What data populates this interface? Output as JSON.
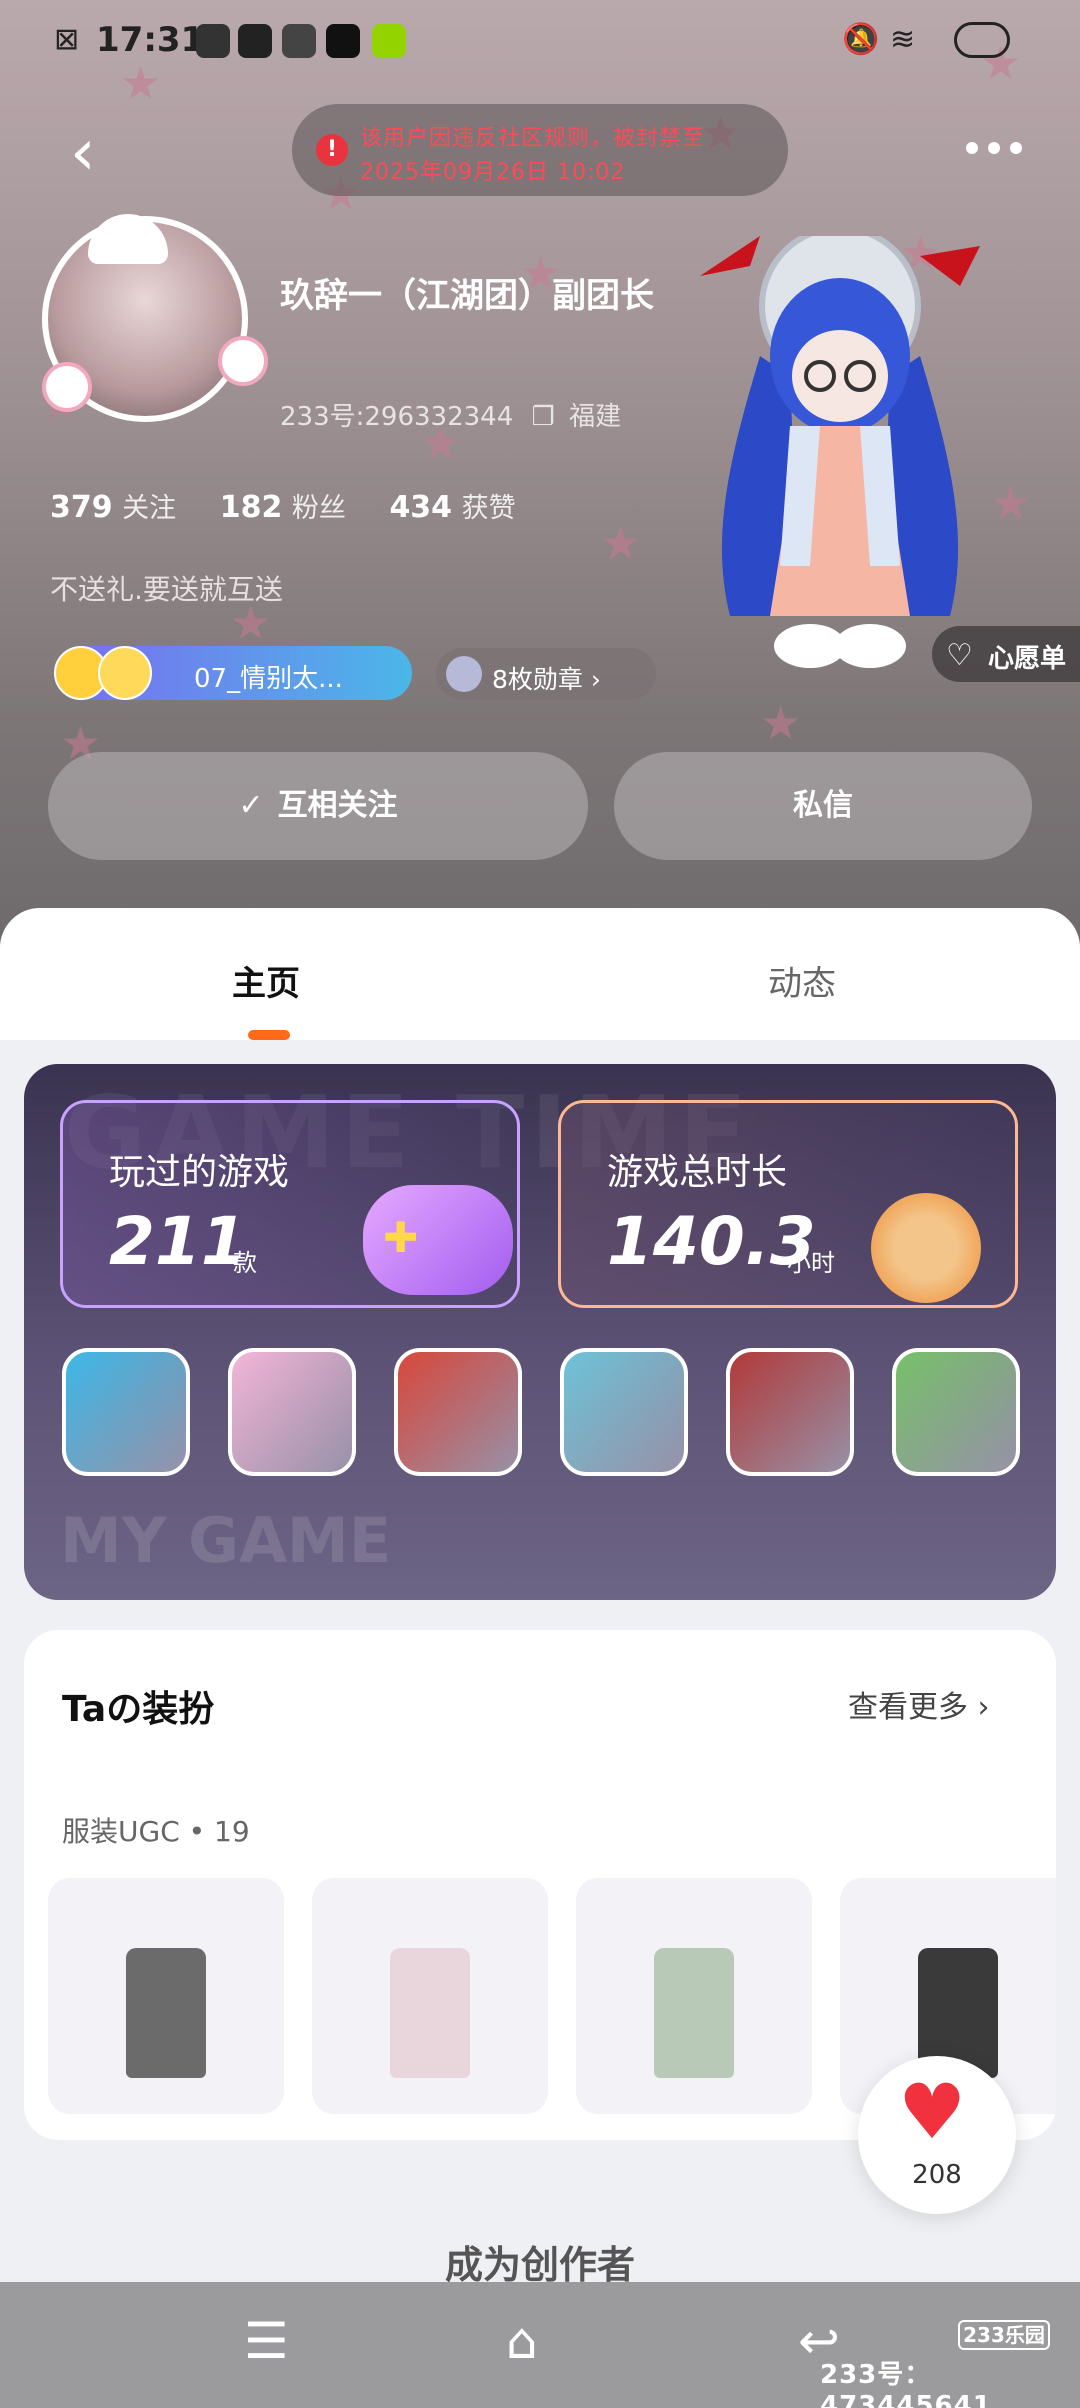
{
  "status_bar": {
    "time": "17:31"
  },
  "header": {
    "ban_notice_line1": "该用户因违反社区规则，被封禁至",
    "ban_notice_line2": "2025年09月26日 10:02"
  },
  "profile": {
    "nickname": "玖辞一（江湖团）副团长",
    "uid": "233号:296332344",
    "location": "福建",
    "following_count": "379",
    "following_label": "关注",
    "fans_count": "182",
    "fans_label": "粉丝",
    "likes_count": "434",
    "likes_label": "获赞",
    "signature": "不送礼.要送就互送",
    "group_chip": "07_情别太...",
    "badge_chip": "8枚勋章",
    "wishlist": "心愿单",
    "follow_button": "互相关注",
    "message_button": "私信"
  },
  "tabs": [
    {
      "label": "主页"
    },
    {
      "label": "动态"
    }
  ],
  "game_card": {
    "watermark_top": "GAME TIME",
    "watermark_bottom": "MY GAME",
    "played_label": "玩过的游戏",
    "played_count": "211",
    "played_unit": "款",
    "duration_label": "游戏总时长",
    "duration_value": "140.3",
    "duration_unit": "小时",
    "icon_colors": [
      "#3db8e8",
      "#f3b6d8",
      "#d9483c",
      "#6ec3d8",
      "#b33a3a",
      "#77c16a"
    ]
  },
  "outfit_card": {
    "title": "Taの装扮",
    "more": "查看更多",
    "subtitle": "服装UGC • 19",
    "items": [
      {
        "color": "#6b6b6b"
      },
      {
        "color": "#e9d6dd"
      },
      {
        "color": "#b8c9b8"
      },
      {
        "color": "#3a3a3a"
      }
    ]
  },
  "like_fab": {
    "count": "208"
  },
  "footer": {
    "become_creator": "成为创作者"
  },
  "watermark": {
    "logo": "233乐园",
    "id": "233号：473445641"
  }
}
